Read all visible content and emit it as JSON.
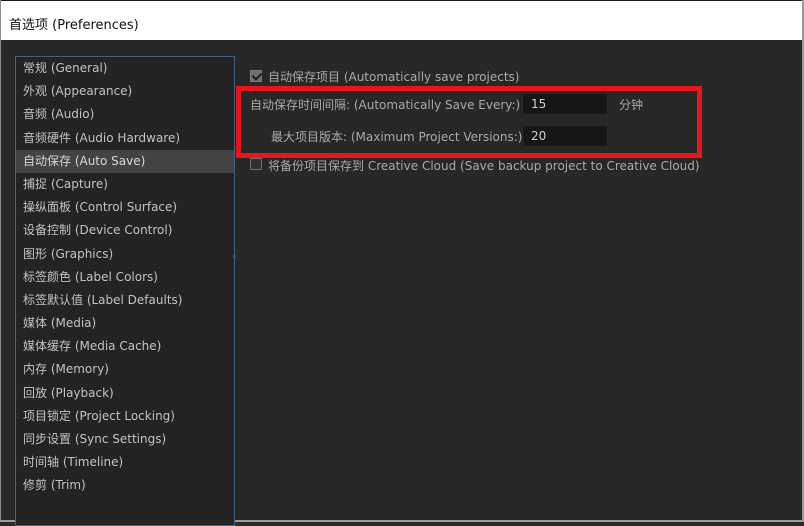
{
  "window": {
    "title": "首选项 (Preferences)"
  },
  "sidebar": {
    "items": [
      {
        "label": "常规 (General)"
      },
      {
        "label": "外观 (Appearance)"
      },
      {
        "label": "音频 (Audio)"
      },
      {
        "label": "音频硬件 (Audio Hardware)"
      },
      {
        "label": "自动保存 (Auto Save)",
        "selected": true
      },
      {
        "label": "捕捉 (Capture)"
      },
      {
        "label": "操纵面板 (Control Surface)"
      },
      {
        "label": "设备控制 (Device Control)"
      },
      {
        "label": "图形 (Graphics)"
      },
      {
        "label": "标签颜色 (Label Colors)"
      },
      {
        "label": "标签默认值 (Label Defaults)"
      },
      {
        "label": "媒体 (Media)"
      },
      {
        "label": "媒体缓存 (Media Cache)"
      },
      {
        "label": "内存 (Memory)"
      },
      {
        "label": "回放 (Playback)"
      },
      {
        "label": "项目锁定 (Project Locking)"
      },
      {
        "label": "同步设置 (Sync Settings)"
      },
      {
        "label": "时间轴 (Timeline)"
      },
      {
        "label": "修剪 (Trim)"
      }
    ]
  },
  "auto_save": {
    "enable_label": "自动保存项目 (Automatically save projects)",
    "enable_checked": true,
    "interval_label": "自动保存时间间隔: (Automatically Save Every:)",
    "interval_value": "15",
    "interval_unit": "分钟",
    "max_versions_label": "最大项目版本: (Maximum Project Versions:)",
    "max_versions_value": "20",
    "cloud_backup_label": "将备份项目保存到 Creative Cloud (Save backup project to Creative Cloud)",
    "cloud_backup_checked": false
  },
  "colors": {
    "annotation_box": "#e8141c",
    "panel_bg": "#272727",
    "sidebar_border": "#3d5f82",
    "selected_bg": "#434343"
  }
}
